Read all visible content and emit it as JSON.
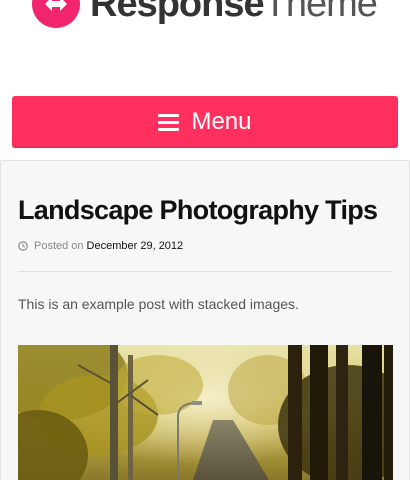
{
  "site": {
    "logo_strong": "Response",
    "logo_light": "Theme"
  },
  "nav": {
    "menu_label": "Menu"
  },
  "post": {
    "title": "Landscape Photography Tips",
    "meta_prefix": "Posted on",
    "date": "December 29, 2012",
    "excerpt": "This is an example post with stacked images."
  },
  "colors": {
    "brand_pink": "#ff2f5e",
    "logo_pink": "#f0256d"
  },
  "icons": {
    "logo": "double-arrow-icon",
    "menu": "hamburger-icon",
    "date": "clock-icon"
  }
}
